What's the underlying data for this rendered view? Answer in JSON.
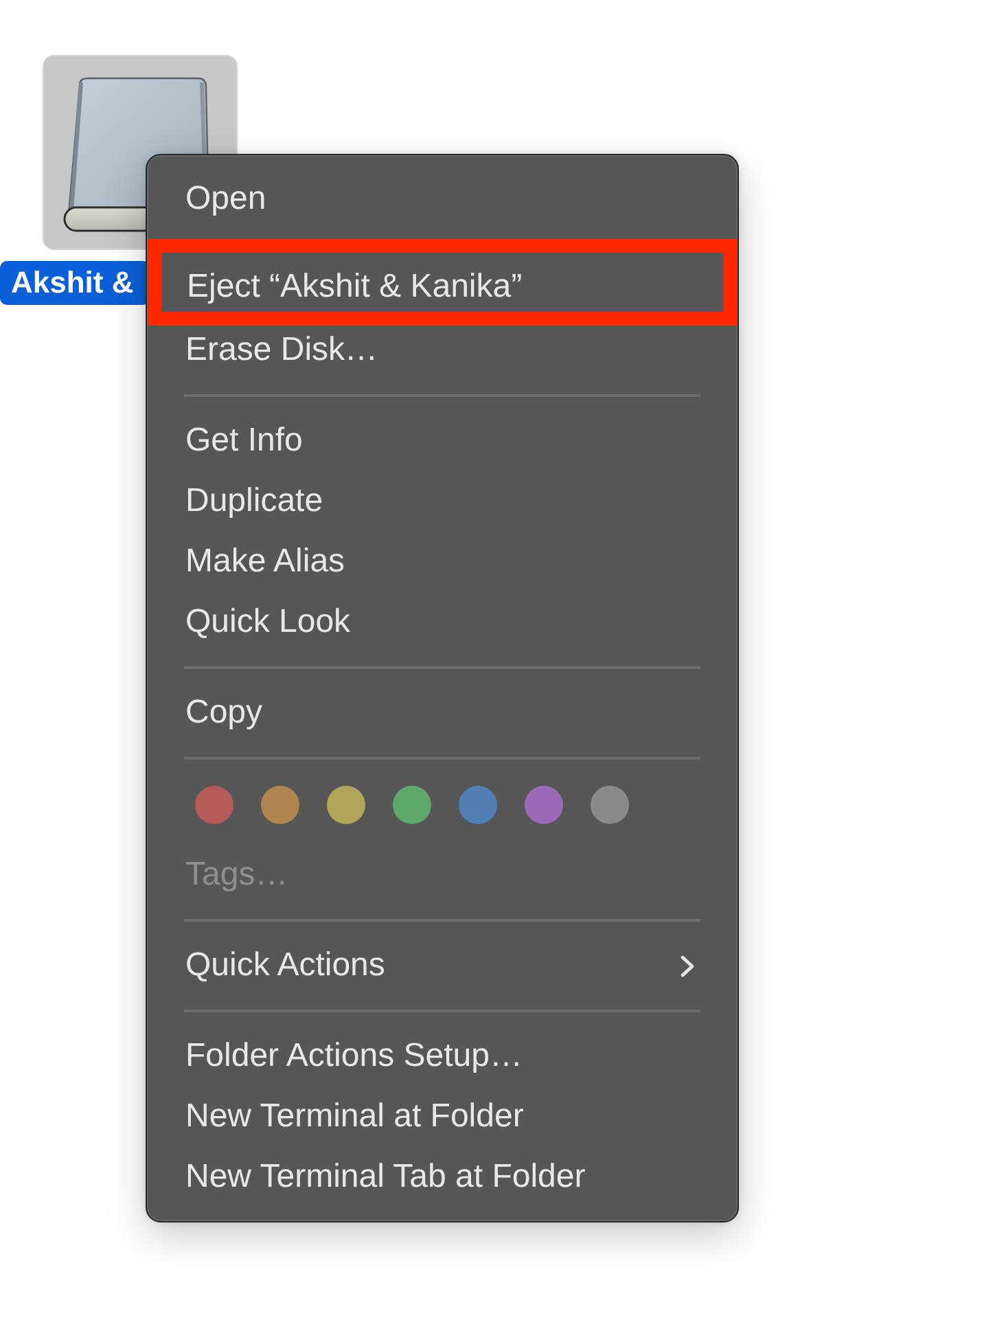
{
  "desktop_icon": {
    "label": "Akshit &",
    "selected": true
  },
  "context_menu": {
    "entries": [
      {
        "kind": "item",
        "label": "Open",
        "disabled": false,
        "submenu": false,
        "highlighted": false
      },
      {
        "kind": "item",
        "label": "Eject “Akshit & Kanika”",
        "disabled": false,
        "submenu": false,
        "highlighted": true
      },
      {
        "kind": "item",
        "label": "Erase Disk…",
        "disabled": false,
        "submenu": false,
        "highlighted": false
      },
      {
        "kind": "separator"
      },
      {
        "kind": "item",
        "label": "Get Info",
        "disabled": false,
        "submenu": false,
        "highlighted": false
      },
      {
        "kind": "item",
        "label": "Duplicate",
        "disabled": false,
        "submenu": false,
        "highlighted": false
      },
      {
        "kind": "item",
        "label": "Make Alias",
        "disabled": false,
        "submenu": false,
        "highlighted": false
      },
      {
        "kind": "item",
        "label": "Quick Look",
        "disabled": false,
        "submenu": false,
        "highlighted": false
      },
      {
        "kind": "separator"
      },
      {
        "kind": "item",
        "label": "Copy",
        "disabled": false,
        "submenu": false,
        "highlighted": false
      },
      {
        "kind": "separator"
      },
      {
        "kind": "tags",
        "tags": [
          {
            "color": "#b65b59"
          },
          {
            "color": "#b0864f"
          },
          {
            "color": "#b1a55a"
          },
          {
            "color": "#5ea86a"
          },
          {
            "color": "#5080b6"
          },
          {
            "color": "#9c6bb8"
          },
          {
            "color": "#8a8a8a"
          }
        ]
      },
      {
        "kind": "item",
        "label": "Tags…",
        "disabled": true,
        "submenu": false,
        "highlighted": false
      },
      {
        "kind": "separator"
      },
      {
        "kind": "item",
        "label": "Quick Actions",
        "disabled": false,
        "submenu": true,
        "highlighted": false
      },
      {
        "kind": "separator"
      },
      {
        "kind": "item",
        "label": "Folder Actions Setup…",
        "disabled": false,
        "submenu": false,
        "highlighted": false
      },
      {
        "kind": "item",
        "label": "New Terminal at Folder",
        "disabled": false,
        "submenu": false,
        "highlighted": false
      },
      {
        "kind": "item",
        "label": "New Terminal Tab at Folder",
        "disabled": false,
        "submenu": false,
        "highlighted": false
      }
    ]
  }
}
